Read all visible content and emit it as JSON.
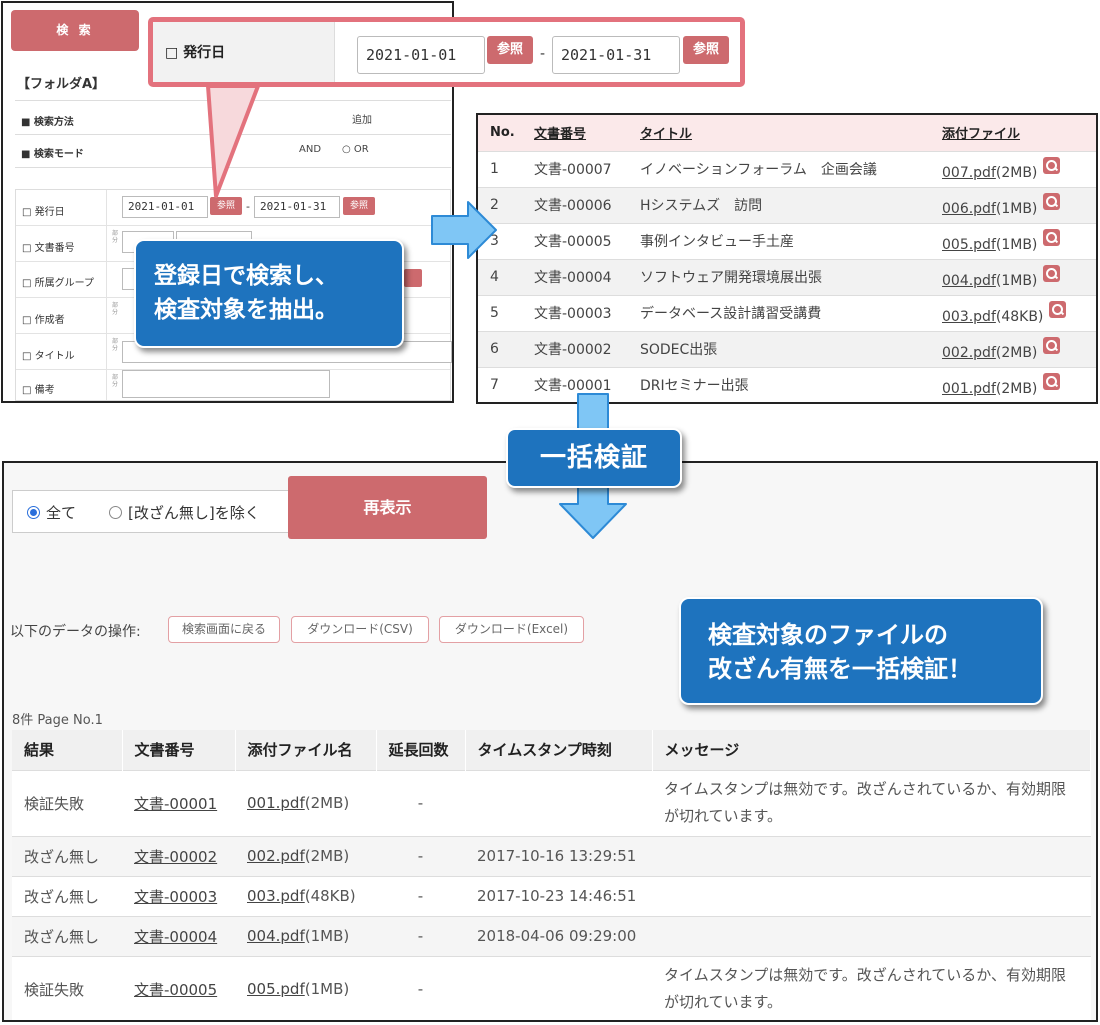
{
  "colors": {
    "accent": "#cd6a6e",
    "callout": "#1e73be",
    "zoom_border": "#e3727d",
    "arrow": "#7fc6f5"
  },
  "search": {
    "button": "検 索",
    "folder": "【フォルダA】",
    "method_label": "■ 検索方法",
    "method_option": "追加",
    "mode_label": "■ 検索モード",
    "mode_and": "AND",
    "mode_or": "○ OR",
    "fields": [
      {
        "label": "□ 発行日"
      },
      {
        "label": "□ 文書番号"
      },
      {
        "label": "□ 所属グループ"
      },
      {
        "label": "□ 作成者"
      },
      {
        "label": "□ タイトル"
      },
      {
        "label": "□ 備考"
      }
    ],
    "mini_label": "部分",
    "date_from": "2021-01-01",
    "date_to": "2021-01-31",
    "ref": "参照",
    "dash": "-"
  },
  "zoom": {
    "label": "□ 発行日",
    "date_from": "2021-01-01",
    "date_to": "2021-01-31",
    "ref": "参照",
    "dash": "-"
  },
  "callouts": {
    "search_line1": "登録日で検索し、",
    "search_line2": "検査対象を抽出。",
    "batch": "一括検証",
    "verify_line1": "検査対象のファイルの",
    "verify_line2": "改ざん有無を一括検証！"
  },
  "doc_list": {
    "headers": [
      "No.",
      "文書番号",
      "タイトル",
      "添付ファイル"
    ],
    "rows": [
      {
        "no": "1",
        "doc": "文書-00007",
        "title": "イノベーションフォーラム　企画会議",
        "file": "007.pdf",
        "size": "(2MB)"
      },
      {
        "no": "2",
        "doc": "文書-00006",
        "title": "Hシステムズ　訪問",
        "file": "006.pdf",
        "size": "(1MB)"
      },
      {
        "no": "3",
        "doc": "文書-00005",
        "title": "事例インタビュー手土産",
        "file": "005.pdf",
        "size": "(1MB)"
      },
      {
        "no": "4",
        "doc": "文書-00004",
        "title": "ソフトウェア開発環境展出張",
        "file": "004.pdf",
        "size": "(1MB)"
      },
      {
        "no": "5",
        "doc": "文書-00003",
        "title": "データベース設計講習受講費",
        "file": "003.pdf",
        "size": "(48KB)"
      },
      {
        "no": "6",
        "doc": "文書-00002",
        "title": "SODEC出張",
        "file": "002.pdf",
        "size": "(2MB)"
      },
      {
        "no": "7",
        "doc": "文書-00001",
        "title": "DRIセミナー出張",
        "file": "001.pdf",
        "size": "(2MB)"
      }
    ]
  },
  "verify": {
    "radio_all": "全て",
    "radio_exclude": "[改ざん無し]を除く",
    "redisplay": "再表示",
    "ops_label": "以下のデータの操作:",
    "op_back": "検索画面に戻る",
    "op_csv": "ダウンロード(CSV)",
    "op_excel": "ダウンロード(Excel)",
    "page_info": "8件 Page No.1",
    "headers": [
      "結果",
      "文書番号",
      "添付ファイル名",
      "延長回数",
      "タイムスタンプ時刻",
      "メッセージ"
    ],
    "rows": [
      {
        "result": "検証失敗",
        "doc": "文書-00001",
        "file": "001.pdf",
        "size": "(2MB)",
        "ext": "-",
        "time": "",
        "msg": "タイムスタンプは無効です。改ざんされているか、有効期限が切れています。"
      },
      {
        "result": "改ざん無し",
        "doc": "文書-00002",
        "file": "002.pdf",
        "size": "(2MB)",
        "ext": "-",
        "time": "2017-10-16 13:29:51",
        "msg": ""
      },
      {
        "result": "改ざん無し",
        "doc": "文書-00003",
        "file": "003.pdf",
        "size": "(48KB)",
        "ext": "-",
        "time": "2017-10-23 14:46:51",
        "msg": ""
      },
      {
        "result": "改ざん無し",
        "doc": "文書-00004",
        "file": "004.pdf",
        "size": "(1MB)",
        "ext": "-",
        "time": "2018-04-06 09:29:00",
        "msg": ""
      },
      {
        "result": "検証失敗",
        "doc": "文書-00005",
        "file": "005.pdf",
        "size": "(1MB)",
        "ext": "-",
        "time": "",
        "msg": "タイムスタンプは無効です。改ざんされているか、有効期限が切れています。"
      }
    ]
  }
}
